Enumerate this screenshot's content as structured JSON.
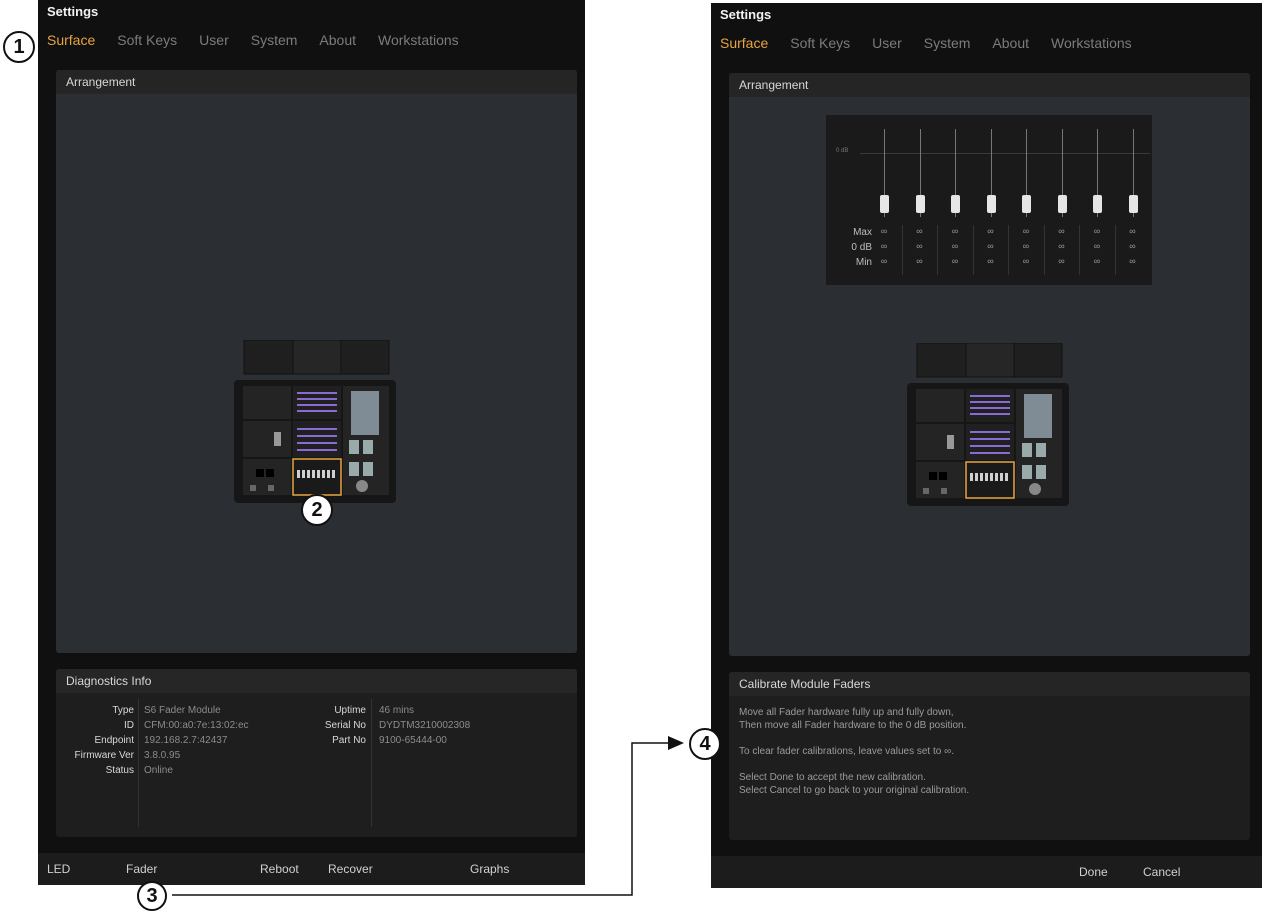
{
  "settings_title": "Settings",
  "tabs": [
    "Surface",
    "Soft Keys",
    "User",
    "System",
    "About",
    "Workstations"
  ],
  "active_tab_color": "#e7a441",
  "arrangement_label": "Arrangement",
  "diagnostics": {
    "title": "Diagnostics Info",
    "left": [
      {
        "key": "Type",
        "value": "S6 Fader Module"
      },
      {
        "key": "ID",
        "value": "CFM:00:a0:7e:13:02:ec"
      },
      {
        "key": "Endpoint",
        "value": "192.168.2.7:42437"
      },
      {
        "key": "Firmware Ver",
        "value": "3.8.0.95"
      },
      {
        "key": "Status",
        "value": "Online"
      }
    ],
    "right": [
      {
        "key": "Uptime",
        "value": "46 mins"
      },
      {
        "key": "Serial No",
        "value": "DYDTM3210002308"
      },
      {
        "key": "Part No",
        "value": "9100-65444-00"
      }
    ]
  },
  "bottom_buttons": {
    "led": "LED",
    "fader": "Fader",
    "reboot": "Reboot",
    "recover": "Recover",
    "graphs": "Graphs"
  },
  "fader_graph": {
    "zero_db_label": "0 dB",
    "row_labels": [
      "Max",
      "0 dB",
      "Min"
    ],
    "cell_value": "∞",
    "fader_count": 8
  },
  "calibrate": {
    "title": "Calibrate Module Faders",
    "lines": [
      "Move all Fader hardware fully up and fully down,",
      "Then move all Fader hardware to the 0 dB position.",
      "",
      "To clear fader calibrations, leave values set to ∞.",
      "",
      "Select Done to accept the new calibration.",
      "Select Cancel to go back to your original calibration."
    ]
  },
  "done_label": "Done",
  "cancel_label": "Cancel",
  "callouts": [
    "1",
    "2",
    "3",
    "4"
  ]
}
